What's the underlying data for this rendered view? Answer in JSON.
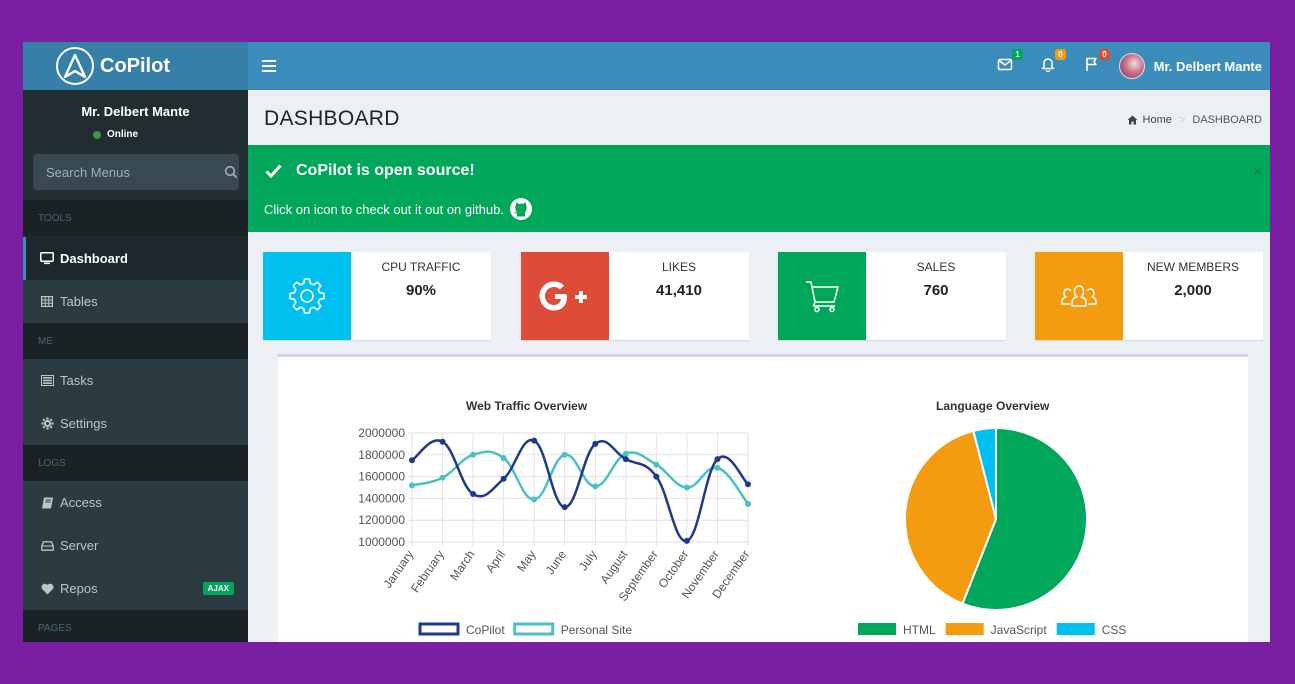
{
  "brand": {
    "name": "CoPilot"
  },
  "header": {
    "user_name": "Mr. Delbert Mante",
    "badges": {
      "messages": "1",
      "notifications": "0",
      "flags": "0"
    },
    "badge_colors": {
      "messages": "#00a65a",
      "notifications": "#f39c12",
      "flags": "#dd4b39"
    }
  },
  "sidebar": {
    "user_name": "Mr. Delbert Mante",
    "status": "Online",
    "search_placeholder": "Search Menus",
    "sections": [
      "TOOLS",
      "ME",
      "LOGS",
      "PAGES"
    ],
    "items": [
      {
        "label": "Dashboard",
        "icon": "desktop-icon"
      },
      {
        "label": "Tables",
        "icon": "table-icon"
      },
      {
        "label": "Tasks",
        "icon": "tasks-icon"
      },
      {
        "label": "Settings",
        "icon": "gear-icon"
      },
      {
        "label": "Access",
        "icon": "book-icon"
      },
      {
        "label": "Server",
        "icon": "hdd-icon"
      },
      {
        "label": "Repos",
        "icon": "heart-icon",
        "badge": "AJAX"
      }
    ]
  },
  "page": {
    "title": "DASHBOARD",
    "breadcrumb": {
      "home": "Home",
      "current": "DASHBOARD"
    }
  },
  "alert": {
    "title": "CoPilot is open source!",
    "text": "Click on icon to check out it out on github.",
    "close": "×"
  },
  "info_boxes": [
    {
      "label": "CPU TRAFFIC",
      "value": "90%",
      "color": "#00c0ef",
      "icon": "gear-icon"
    },
    {
      "label": "LIKES",
      "value": "41,410",
      "color": "#dd4b39",
      "icon": "google-plus-icon"
    },
    {
      "label": "SALES",
      "value": "760",
      "color": "#00a65a",
      "icon": "shopping-cart-icon"
    },
    {
      "label": "NEW MEMBERS",
      "value": "2,000",
      "color": "#f39c12",
      "icon": "users-icon"
    }
  ],
  "chart_data": [
    {
      "type": "line",
      "title": "Web Traffic Overview",
      "categories": [
        "January",
        "February",
        "March",
        "April",
        "May",
        "June",
        "July",
        "August",
        "September",
        "October",
        "November",
        "December"
      ],
      "series": [
        {
          "name": "CoPilot",
          "color": "#1e3a8a",
          "values": [
            1750000,
            1920000,
            1440000,
            1580000,
            1930000,
            1320000,
            1900000,
            1760000,
            1600000,
            1010000,
            1760000,
            1530000
          ]
        },
        {
          "name": "Personal Site",
          "color": "#4cc1c1",
          "values": [
            1520000,
            1590000,
            1800000,
            1770000,
            1390000,
            1800000,
            1510000,
            1810000,
            1710000,
            1500000,
            1680000,
            1350000
          ]
        }
      ],
      "yticks": [
        "2000000",
        "1800000",
        "1600000",
        "1400000",
        "1200000",
        "1000000"
      ],
      "ylim": [
        1000000,
        2000000
      ]
    },
    {
      "type": "pie",
      "title": "Language Overview",
      "labels": [
        "HTML",
        "JavaScript",
        "CSS"
      ],
      "values": [
        56,
        40,
        4
      ],
      "colors": [
        "#00a65a",
        "#f39c12",
        "#00c0ef"
      ]
    }
  ]
}
